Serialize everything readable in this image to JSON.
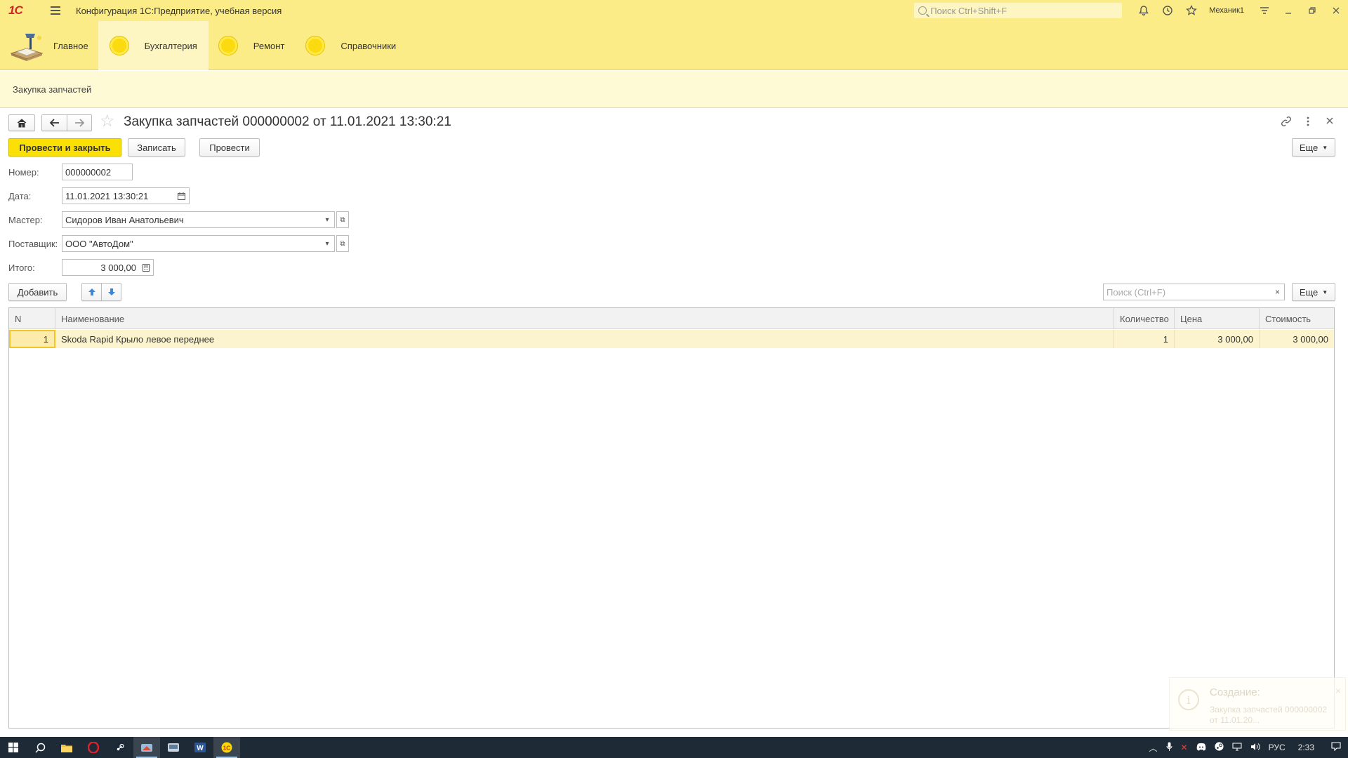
{
  "titlebar": {
    "logo": "1С",
    "app_title": "Конфигурация 1С:Предприятие, учебная версия",
    "search_placeholder": "Поиск Ctrl+Shift+F",
    "user": "Механик1"
  },
  "sections": {
    "items": [
      {
        "label": "Главное"
      },
      {
        "label": "Бухгалтерия"
      },
      {
        "label": "Ремонт"
      },
      {
        "label": "Справочники"
      }
    ],
    "active_color": "#FDF6C3",
    "panel_color": "#FBEC88"
  },
  "openbar": {
    "tab_label": "Закупка запчастей"
  },
  "form": {
    "title": "Закупка запчастей 000000002 от 11.01.2021 13:30:21",
    "buttons": {
      "post_close": "Провести и закрыть",
      "save": "Записать",
      "post": "Провести",
      "more": "Еще"
    },
    "fields": {
      "number_label": "Номер:",
      "number_value": "000000002",
      "date_label": "Дата:",
      "date_value": "11.01.2021 13:30:21",
      "master_label": "Мастер:",
      "master_value": "Сидоров Иван Анатольевич",
      "supplier_label": "Поставщик:",
      "supplier_value": "ООО \"АвтоДом\"",
      "total_label": "Итого:",
      "total_value": "3 000,00"
    },
    "table_toolbar": {
      "add": "Добавить",
      "search_placeholder": "Поиск (Ctrl+F)",
      "more": "Еще"
    },
    "table": {
      "columns": [
        "N",
        "Наименование",
        "Количество",
        "Цена",
        "Стоимость"
      ],
      "rows": [
        [
          "1",
          "Skoda Rapid Крыло левое переднее",
          "1",
          "3 000,00",
          "3 000,00"
        ]
      ]
    }
  },
  "notification": {
    "title": "Создание:",
    "body": "Закупка запчастей 000000002 от 11.01.20..."
  },
  "taskbar": {
    "lang": "РУС",
    "time": "2:33"
  },
  "colors": {
    "accent_yellow": "#FBE005",
    "panel_yellow": "#FBEC88",
    "row_highlight": "#FCF4CF"
  }
}
